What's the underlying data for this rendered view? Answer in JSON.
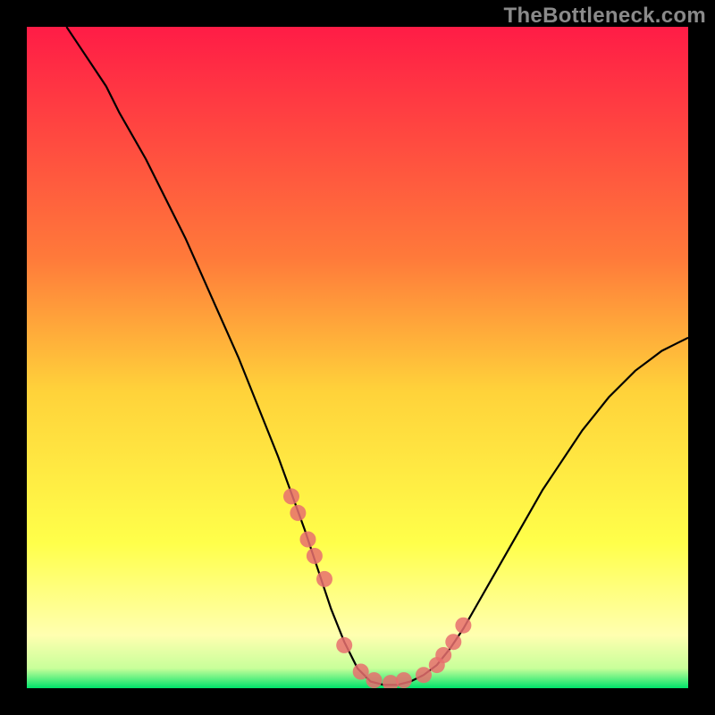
{
  "watermark": "TheBottleneck.com",
  "colors": {
    "background": "#000000",
    "curve": "#000000",
    "marker_fill": "#e86f6f",
    "marker_stroke": "#d85a5a",
    "gradient_top": "#ff1c46",
    "gradient_mid_upper": "#ff7a3a",
    "gradient_mid": "#ffd23a",
    "gradient_mid_lower": "#ffff4a",
    "gradient_low": "#ffffb0",
    "gradient_bottom": "#00e36a"
  },
  "chart_data": {
    "type": "line",
    "title": "",
    "xlabel": "",
    "ylabel": "",
    "xlim": [
      0,
      100
    ],
    "ylim": [
      0,
      100
    ],
    "grid": false,
    "legend": false,
    "series": [
      {
        "name": "bottleneck-curve",
        "x": [
          6,
          8,
          10,
          12,
          14,
          16,
          18,
          20,
          22,
          24,
          26,
          28,
          30,
          32,
          34,
          36,
          38,
          40,
          42,
          44,
          46,
          48,
          50,
          52,
          54,
          56,
          58,
          60,
          62,
          64,
          66,
          68,
          70,
          72,
          74,
          76,
          78,
          80,
          82,
          84,
          86,
          88,
          90,
          92,
          94,
          96,
          98,
          100
        ],
        "y": [
          100,
          97,
          94,
          91,
          87,
          83.5,
          80,
          76,
          72,
          68,
          63.5,
          59,
          54.5,
          50,
          45,
          40,
          35,
          29.5,
          24,
          18,
          12,
          7,
          3,
          1,
          0.5,
          0.5,
          1,
          2,
          3.5,
          6,
          9,
          12.5,
          16,
          19.5,
          23,
          26.5,
          30,
          33,
          36,
          39,
          41.5,
          44,
          46,
          48,
          49.5,
          51,
          52,
          53
        ]
      }
    ],
    "markers": {
      "name": "highlighted-points",
      "x": [
        40,
        41,
        42.5,
        43.5,
        45,
        48,
        50.5,
        52.5,
        55,
        57,
        60,
        62,
        63,
        64.5,
        66
      ],
      "y": [
        29,
        26.5,
        22.5,
        20,
        16.5,
        6.5,
        2.5,
        1.2,
        0.8,
        1.2,
        2,
        3.5,
        5,
        7,
        9.5
      ]
    }
  }
}
